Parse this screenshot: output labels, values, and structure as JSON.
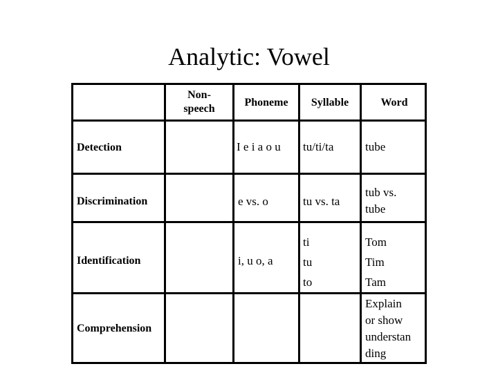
{
  "title": "Analytic:  Vowel",
  "table": {
    "headers": [
      "",
      "Non-\nspeech",
      "Phoneme",
      "Syllable",
      "Word"
    ],
    "header_nonspeech_line1": "Non-",
    "header_nonspeech_line2": "speech",
    "header_phoneme": "Phoneme",
    "header_syllable": "Syllable",
    "header_word": "Word",
    "rows": [
      {
        "label": "Detection",
        "nonspeech": "",
        "phoneme": "I e i a o u",
        "syllable": "tu/ti/ta",
        "word": "tube"
      },
      {
        "label": "Discrimination",
        "nonspeech": "",
        "phoneme": "e vs. o",
        "syllable": "tu vs. ta",
        "word_line1": "tub vs.",
        "word_line2": "tube"
      },
      {
        "label": "Identification",
        "nonspeech": "",
        "phoneme": "i, u o, a",
        "syllable_lines": [
          "ti",
          "tu",
          "to"
        ],
        "word_lines": [
          "Tom",
          "Tim",
          "Tam"
        ]
      },
      {
        "label": "Comprehension",
        "nonspeech": "",
        "phoneme": "",
        "syllable": "",
        "word_lines": [
          "Explain",
          "or show",
          "understan",
          "ding"
        ]
      }
    ]
  }
}
